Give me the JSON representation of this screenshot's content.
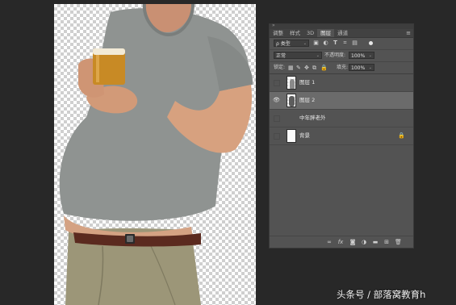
{
  "panel": {
    "tabs": [
      "调整",
      "样式",
      "3D",
      "图层",
      "通道"
    ],
    "active_tab": "图层",
    "menu_icon": "hamburger-menu-icon",
    "collapse_icon": "double-chevron-icon",
    "filter": {
      "kind_label": "ρ 类型",
      "icons": [
        "image-filter-icon",
        "adjustment-filter-icon",
        "type-filter-icon",
        "shape-filter-icon",
        "smart-object-filter-icon"
      ],
      "toggle": "filter-toggle-dot"
    },
    "blend": {
      "mode": "正常",
      "opacity_label": "不透明度:",
      "opacity_value": "100%"
    },
    "lock": {
      "label": "锁定:",
      "fill_label": "填充:",
      "fill_value": "100%"
    },
    "layers": [
      {
        "name": "图层 1",
        "visible": false,
        "selected": false,
        "thumb": "figure"
      },
      {
        "name": "图层 2",
        "visible": true,
        "selected": true,
        "thumb": "figure"
      },
      {
        "name": "中年胖老外",
        "visible": false,
        "selected": false,
        "thumb": "none"
      },
      {
        "name": "背景",
        "visible": false,
        "selected": false,
        "thumb": "white",
        "locked": true
      }
    ],
    "footer_icons": [
      "link-icon",
      "fx-icon",
      "mask-icon",
      "adjustment-icon",
      "group-icon",
      "new-layer-icon",
      "trash-icon"
    ]
  },
  "watermark": "头条号 / 部落窝教育h",
  "colors": {
    "app_bg": "#282828",
    "panel_bg": "#535353",
    "selected_row": "#6b6b6b",
    "shirt": "#8f9391",
    "pants": "#9c9678",
    "skin": "#d7a17f",
    "beer": "#c88a25"
  }
}
